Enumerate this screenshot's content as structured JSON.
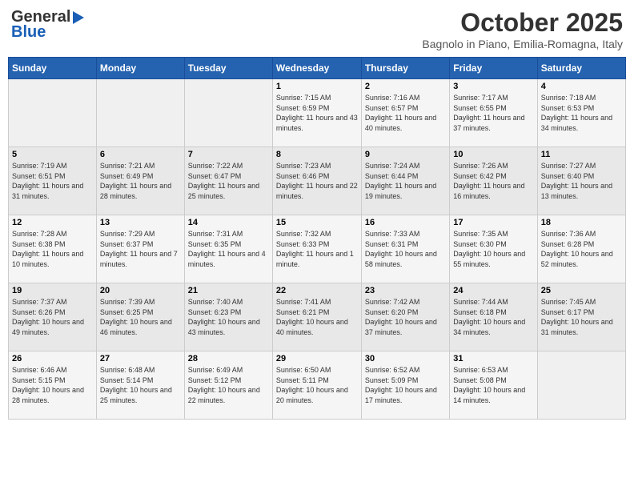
{
  "logo": {
    "general": "General",
    "blue": "Blue"
  },
  "title": {
    "month": "October 2025",
    "location": "Bagnolo in Piano, Emilia-Romagna, Italy"
  },
  "weekdays": [
    "Sunday",
    "Monday",
    "Tuesday",
    "Wednesday",
    "Thursday",
    "Friday",
    "Saturday"
  ],
  "weeks": [
    [
      {
        "day": "",
        "info": ""
      },
      {
        "day": "",
        "info": ""
      },
      {
        "day": "",
        "info": ""
      },
      {
        "day": "1",
        "info": "Sunrise: 7:15 AM\nSunset: 6:59 PM\nDaylight: 11 hours and 43 minutes."
      },
      {
        "day": "2",
        "info": "Sunrise: 7:16 AM\nSunset: 6:57 PM\nDaylight: 11 hours and 40 minutes."
      },
      {
        "day": "3",
        "info": "Sunrise: 7:17 AM\nSunset: 6:55 PM\nDaylight: 11 hours and 37 minutes."
      },
      {
        "day": "4",
        "info": "Sunrise: 7:18 AM\nSunset: 6:53 PM\nDaylight: 11 hours and 34 minutes."
      }
    ],
    [
      {
        "day": "5",
        "info": "Sunrise: 7:19 AM\nSunset: 6:51 PM\nDaylight: 11 hours and 31 minutes."
      },
      {
        "day": "6",
        "info": "Sunrise: 7:21 AM\nSunset: 6:49 PM\nDaylight: 11 hours and 28 minutes."
      },
      {
        "day": "7",
        "info": "Sunrise: 7:22 AM\nSunset: 6:47 PM\nDaylight: 11 hours and 25 minutes."
      },
      {
        "day": "8",
        "info": "Sunrise: 7:23 AM\nSunset: 6:46 PM\nDaylight: 11 hours and 22 minutes."
      },
      {
        "day": "9",
        "info": "Sunrise: 7:24 AM\nSunset: 6:44 PM\nDaylight: 11 hours and 19 minutes."
      },
      {
        "day": "10",
        "info": "Sunrise: 7:26 AM\nSunset: 6:42 PM\nDaylight: 11 hours and 16 minutes."
      },
      {
        "day": "11",
        "info": "Sunrise: 7:27 AM\nSunset: 6:40 PM\nDaylight: 11 hours and 13 minutes."
      }
    ],
    [
      {
        "day": "12",
        "info": "Sunrise: 7:28 AM\nSunset: 6:38 PM\nDaylight: 11 hours and 10 minutes."
      },
      {
        "day": "13",
        "info": "Sunrise: 7:29 AM\nSunset: 6:37 PM\nDaylight: 11 hours and 7 minutes."
      },
      {
        "day": "14",
        "info": "Sunrise: 7:31 AM\nSunset: 6:35 PM\nDaylight: 11 hours and 4 minutes."
      },
      {
        "day": "15",
        "info": "Sunrise: 7:32 AM\nSunset: 6:33 PM\nDaylight: 11 hours and 1 minute."
      },
      {
        "day": "16",
        "info": "Sunrise: 7:33 AM\nSunset: 6:31 PM\nDaylight: 10 hours and 58 minutes."
      },
      {
        "day": "17",
        "info": "Sunrise: 7:35 AM\nSunset: 6:30 PM\nDaylight: 10 hours and 55 minutes."
      },
      {
        "day": "18",
        "info": "Sunrise: 7:36 AM\nSunset: 6:28 PM\nDaylight: 10 hours and 52 minutes."
      }
    ],
    [
      {
        "day": "19",
        "info": "Sunrise: 7:37 AM\nSunset: 6:26 PM\nDaylight: 10 hours and 49 minutes."
      },
      {
        "day": "20",
        "info": "Sunrise: 7:39 AM\nSunset: 6:25 PM\nDaylight: 10 hours and 46 minutes."
      },
      {
        "day": "21",
        "info": "Sunrise: 7:40 AM\nSunset: 6:23 PM\nDaylight: 10 hours and 43 minutes."
      },
      {
        "day": "22",
        "info": "Sunrise: 7:41 AM\nSunset: 6:21 PM\nDaylight: 10 hours and 40 minutes."
      },
      {
        "day": "23",
        "info": "Sunrise: 7:42 AM\nSunset: 6:20 PM\nDaylight: 10 hours and 37 minutes."
      },
      {
        "day": "24",
        "info": "Sunrise: 7:44 AM\nSunset: 6:18 PM\nDaylight: 10 hours and 34 minutes."
      },
      {
        "day": "25",
        "info": "Sunrise: 7:45 AM\nSunset: 6:17 PM\nDaylight: 10 hours and 31 minutes."
      }
    ],
    [
      {
        "day": "26",
        "info": "Sunrise: 6:46 AM\nSunset: 5:15 PM\nDaylight: 10 hours and 28 minutes."
      },
      {
        "day": "27",
        "info": "Sunrise: 6:48 AM\nSunset: 5:14 PM\nDaylight: 10 hours and 25 minutes."
      },
      {
        "day": "28",
        "info": "Sunrise: 6:49 AM\nSunset: 5:12 PM\nDaylight: 10 hours and 22 minutes."
      },
      {
        "day": "29",
        "info": "Sunrise: 6:50 AM\nSunset: 5:11 PM\nDaylight: 10 hours and 20 minutes."
      },
      {
        "day": "30",
        "info": "Sunrise: 6:52 AM\nSunset: 5:09 PM\nDaylight: 10 hours and 17 minutes."
      },
      {
        "day": "31",
        "info": "Sunrise: 6:53 AM\nSunset: 5:08 PM\nDaylight: 10 hours and 14 minutes."
      },
      {
        "day": "",
        "info": ""
      }
    ]
  ]
}
